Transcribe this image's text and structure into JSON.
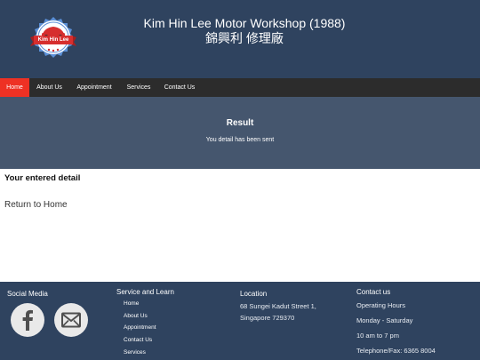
{
  "header": {
    "logo_text": "Kim Hin Lee",
    "title_en": "Kim Hin Lee Motor Workshop (1988)",
    "title_cn": "錦興利 修理廠"
  },
  "nav": {
    "items": [
      {
        "label": "Home",
        "active": true
      },
      {
        "label": "About Us",
        "active": false
      },
      {
        "label": "Appointment",
        "active": false
      },
      {
        "label": "Services",
        "active": false
      },
      {
        "label": "Contact Us",
        "active": false
      }
    ]
  },
  "result": {
    "title": "Result",
    "message": "You detail has been sent"
  },
  "main": {
    "entered_heading": "Your entered detail",
    "return_link": "Return to Home"
  },
  "footer": {
    "social_heading": "Social Media",
    "social_icons": [
      "facebook-icon",
      "mail-icon"
    ],
    "service_heading": "Service and Learn",
    "links": [
      "Home",
      "About Us",
      "Appointment",
      "Contact Us",
      "Services"
    ],
    "location_heading": "Location",
    "address_line1": "68 Sungei Kadut Street 1,",
    "address_line2": "Singapore 729370",
    "contact_heading": "Contact us",
    "hours_label": "Operating Hours",
    "days": "Monday - Saturday",
    "time": "10 am to 7 pm",
    "phone": "Telephone/Fax: 6365 8004"
  },
  "colors": {
    "header_bg": "#2f435f",
    "nav_bg": "#2c2c2c",
    "nav_active": "#ee3124",
    "result_bg": "#45566e",
    "logo_ring": "#5b8fd6",
    "logo_ribbon": "#d62e2e"
  }
}
